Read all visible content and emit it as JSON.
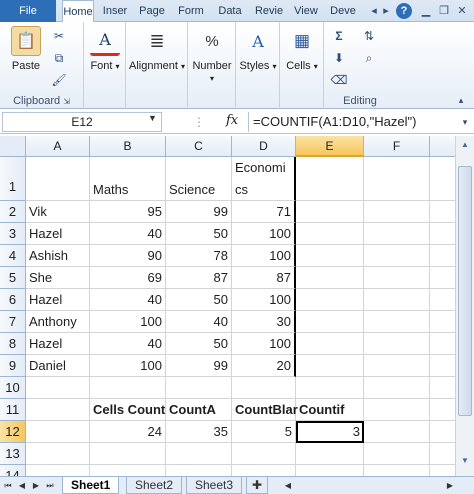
{
  "ribbon_tabs": [
    "File",
    "Home",
    "Inser",
    "Page",
    "Form",
    "Data",
    "Revie",
    "View",
    "Deve"
  ],
  "ribbon": {
    "clipboard": {
      "paste_label": "Paste",
      "group_label": "Clipboard"
    },
    "font_label": "Font",
    "alignment_label": "Alignment",
    "number_label": "Number",
    "styles_label": "Styles",
    "cells_label": "Cells",
    "editing_label": "Editing"
  },
  "formula_bar": {
    "name_box": "E12",
    "fx": "fx",
    "formula": "=COUNTIF(A1:D10,\"Hazel\")"
  },
  "columns": [
    "A",
    "B",
    "C",
    "D",
    "E",
    "F",
    "G"
  ],
  "rows": [
    "1",
    "2",
    "3",
    "4",
    "5",
    "6",
    "7",
    "8",
    "9",
    "10",
    "11",
    "12",
    "13",
    "14",
    "15"
  ],
  "cells": {
    "B1": "Maths",
    "C1": "Science",
    "D1a": "Economi",
    "D1b": "cs",
    "A2": "Vik",
    "B2": "95",
    "C2": "99",
    "D2": "71",
    "A3": "Hazel",
    "B3": "40",
    "C3": "50",
    "D3": "100",
    "A4": "Ashish",
    "B4": "90",
    "C4": "78",
    "D4": "100",
    "A5": "She",
    "B5": "69",
    "C5": "87",
    "D5": "87",
    "A6": "Hazel",
    "B6": "40",
    "C6": "50",
    "D6": "100",
    "A7": "Anthony",
    "B7": "100",
    "C7": "40",
    "D7": "30",
    "A8": "Hazel",
    "B8": "40",
    "C8": "50",
    "D8": "100",
    "A9": "Daniel",
    "B9": "100",
    "C9": "99",
    "D9": "20",
    "B11": "Cells Count",
    "C11": "CountA",
    "D11": "CountBlar",
    "E11": "Countif",
    "B12": "24",
    "C12": "35",
    "D12": "5",
    "E12": "3"
  },
  "sheets": [
    "Sheet1",
    "Sheet2",
    "Sheet3"
  ]
}
